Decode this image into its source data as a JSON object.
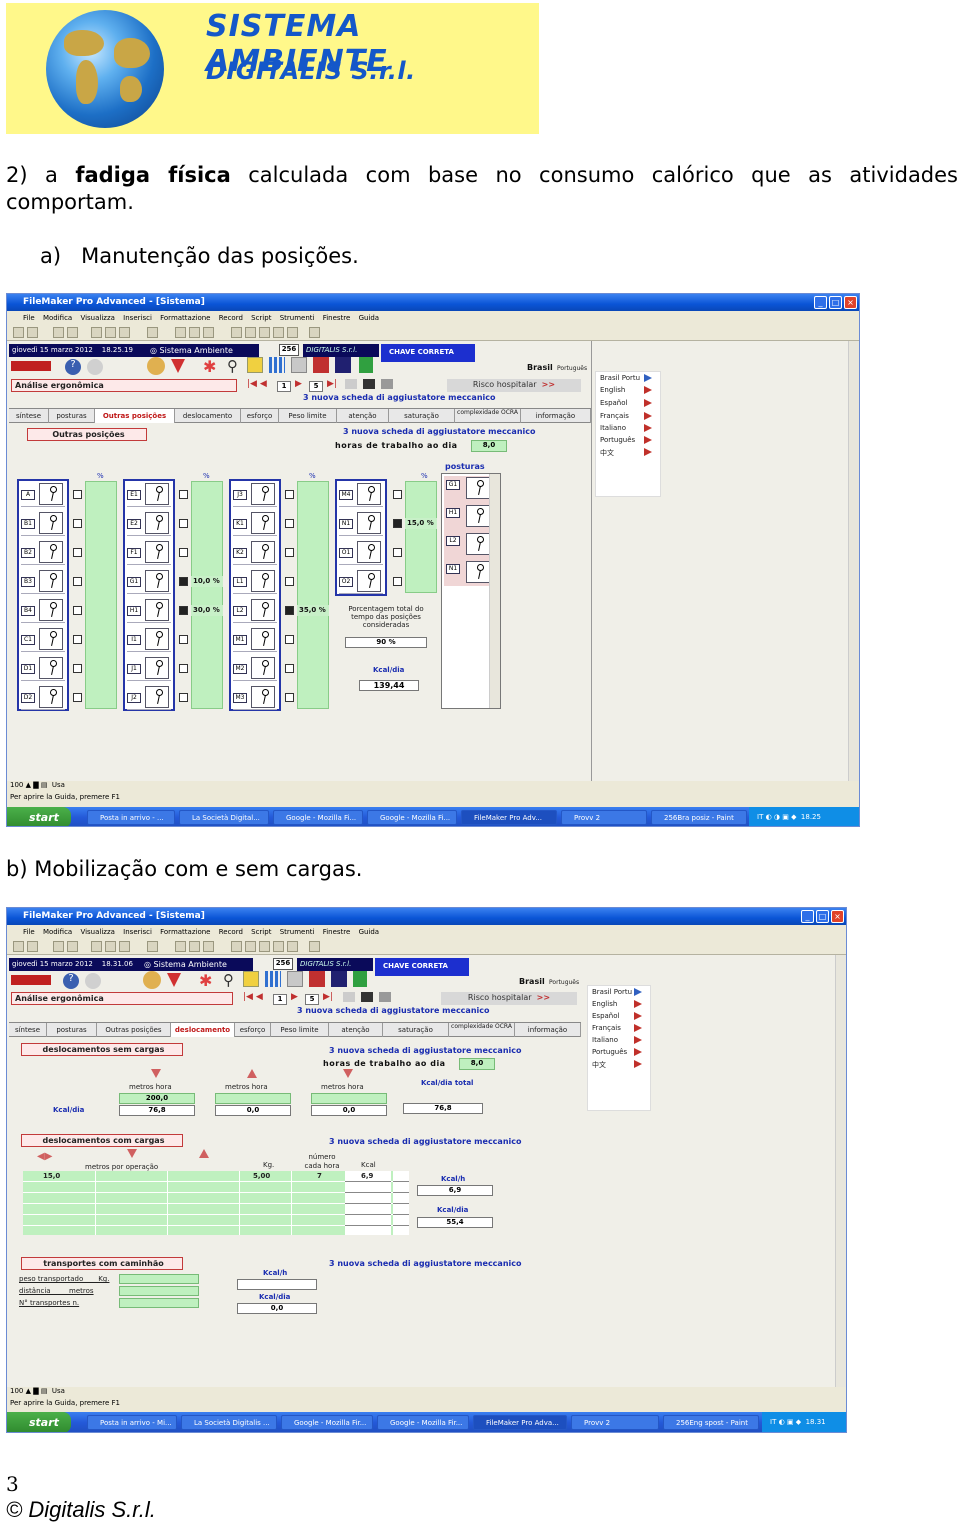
{
  "logo": {
    "line1": "SISTEMA AMBIENTE",
    "line2": "DIGITALIS S.r.l."
  },
  "intro": {
    "prefix": "2) a ",
    "bold": "fadiga física",
    "rest": " calculada com base no consumo calórico que as atividades comportam."
  },
  "section_a": {
    "marker": "a)",
    "text": "Manutenção das posições."
  },
  "section_b": {
    "text": "b) Mobilização com e sem cargas."
  },
  "app": {
    "title": "FileMaker Pro Advanced - [Sistema]",
    "menu": [
      "File",
      "Modifica",
      "Visualizza",
      "Inserisci",
      "Formattazione",
      "Record",
      "Script",
      "Strumenti",
      "Finestre",
      "Guida"
    ],
    "system": "Sistema Ambiente",
    "record_count": "256",
    "brand": "DIGITALIS S.r.l.",
    "key_button": "CHAVE CORRETA",
    "module": "Análise ergonômica",
    "page1": "1",
    "page2": "5",
    "risk": "Risco hospitalar",
    "country": "Brasil",
    "country_lang": "Português",
    "langs": [
      "Brasil Portu",
      "English",
      "Español",
      "Français",
      "Italiano",
      "Português",
      "中文"
    ],
    "tabs": [
      "síntese",
      "posturas",
      "Outras posições",
      "deslocamento",
      "esforço",
      "Peso limite",
      "atenção",
      "saturação",
      "complexidade OCRA",
      "informação"
    ],
    "sheet": "3  nuova scheda di aggiustatore meccanico",
    "hours_label": "horas de trabalho ao dia",
    "hours_value": "8,0",
    "zoom": "100",
    "mode": "Usa",
    "help": "Per aprire la Guida, premere F1",
    "start": "start"
  },
  "screen1": {
    "date": "giovedì 15 marzo 2012",
    "time": "18.25.19",
    "section": "Outras posições",
    "pct_symbol": "%",
    "postures_label": "posturas",
    "columns": [
      [
        "A",
        "B1",
        "B2",
        "B3",
        "B4",
        "C1",
        "D1",
        "D2"
      ],
      [
        "E1",
        "E2",
        "F1",
        "G1",
        "H1",
        "I1",
        "J1",
        "J2"
      ],
      [
        "J3",
        "K1",
        "K2",
        "L1",
        "L2",
        "M1",
        "M2",
        "M3"
      ],
      [
        "M4",
        "N1",
        "O1",
        "O2"
      ]
    ],
    "postures": [
      "G1",
      "H1",
      "L2",
      "N1"
    ],
    "pct_values": {
      "g1": "10,0 %",
      "h1": "30,0 %",
      "l2": "35,0 %",
      "n1": "15,0 %"
    },
    "total_label": "Porcentagem total do tempo das posições consideradas",
    "total_value": "90 %",
    "kcal_label": "Kcal/dia",
    "kcal_value": "139,44",
    "taskbar": [
      "Posta in arrivo - ...",
      "La Società Digital...",
      "Google - Mozilla Fi...",
      "Google - Mozilla Fi...",
      "FileMaker Pro Adv...",
      "Provv 2",
      "256Bra posiz - Paint"
    ],
    "tray_lang": "IT",
    "clock": "18.25"
  },
  "screen2": {
    "date": "giovedì 15 marzo 2012",
    "time": "18.31.06",
    "no_load": "deslocamentos sem cargas",
    "metros_hora": "metros hora",
    "kcal_dia": "Kcal/dia",
    "kcal_dia_total": "Kcal/dia total",
    "row1": [
      "200,0",
      "",
      ""
    ],
    "row2": [
      "76,8",
      "0,0",
      "0,0"
    ],
    "total": "76,8",
    "with_load": "deslocamentos com cargas",
    "metros_op": "metros por operação",
    "kg": "Kg.",
    "numero": "número cada hora",
    "kcal": "Kcal",
    "load_row": {
      "metros": "15,0",
      "kg": "5,00",
      "numero": "7",
      "kcal": "6,9"
    },
    "kcal_h": "Kcal/h",
    "kcal_h_value": "6,9",
    "kcal_dia_value": "55,4",
    "truck": "transportes com caminhão",
    "truck_fields": [
      "peso transportado ___ Kg.",
      "distância ____ metros",
      "N° transportes  n."
    ],
    "truck_kcal_h": "Kcal/h",
    "truck_kcal_dia": "Kcal/dia",
    "truck_value": "0,0",
    "taskbar": [
      "Posta in arrivo - Mi...",
      "La Società Digitalis ...",
      "Google - Mozilla Fir...",
      "Google - Mozilla Fir...",
      "FileMaker Pro Adva...",
      "Provv 2",
      "256Eng spost - Paint"
    ],
    "tray_lang": "IT",
    "clock": "18.31"
  },
  "footer": {
    "page": "3",
    "copyright": "© Digitalis S.r.l."
  }
}
